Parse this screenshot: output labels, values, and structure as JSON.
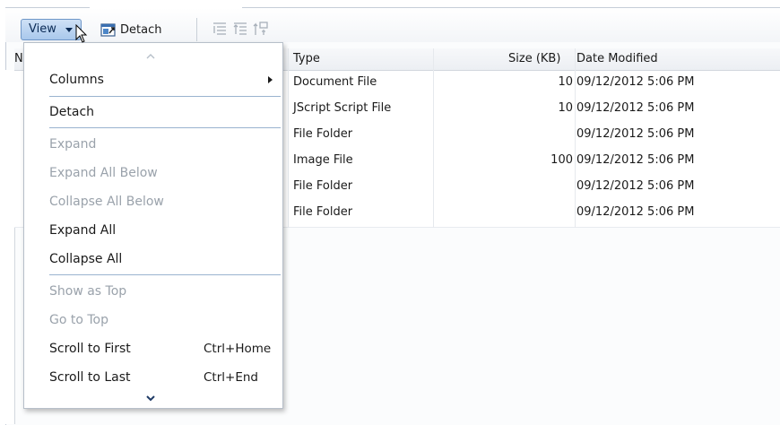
{
  "toolbar": {
    "view_label": "View",
    "detach_label": "Detach"
  },
  "table": {
    "columns": [
      "N",
      "Type",
      "Size (KB)",
      "Date Modified"
    ],
    "rows": [
      {
        "type": "Document File",
        "size": "10",
        "date": "09/12/2012 5:06 PM"
      },
      {
        "type": "JScript Script File",
        "size": "10",
        "date": "09/12/2012 5:06 PM"
      },
      {
        "type": "File Folder",
        "size": "",
        "date": "09/12/2012 5:06 PM"
      },
      {
        "type": "Image File",
        "size": "100",
        "date": "09/12/2012 5:06 PM"
      },
      {
        "type": "File Folder",
        "size": "",
        "date": "09/12/2012 5:06 PM"
      },
      {
        "type": "File Folder",
        "size": "",
        "date": "09/12/2012 5:06 PM"
      }
    ]
  },
  "menu": {
    "items": [
      {
        "label": "Columns",
        "enabled": true,
        "submenu": true
      },
      {
        "label": "Detach",
        "enabled": true
      },
      {
        "label": "Expand",
        "enabled": false
      },
      {
        "label": "Expand All Below",
        "enabled": false
      },
      {
        "label": "Collapse All Below",
        "enabled": false
      },
      {
        "label": "Expand All",
        "enabled": true
      },
      {
        "label": "Collapse All",
        "enabled": true
      },
      {
        "label": "Show as Top",
        "enabled": false
      },
      {
        "label": "Go to Top",
        "enabled": false
      },
      {
        "label": "Scroll to First",
        "enabled": true,
        "shortcut": "Ctrl+Home"
      },
      {
        "label": "Scroll to Last",
        "enabled": true,
        "shortcut": "Ctrl+End"
      }
    ]
  },
  "colors": {
    "view_button": "#a9c8ec",
    "menu_separator": "#9ab3cf",
    "disabled_text": "#9aa2ab"
  }
}
